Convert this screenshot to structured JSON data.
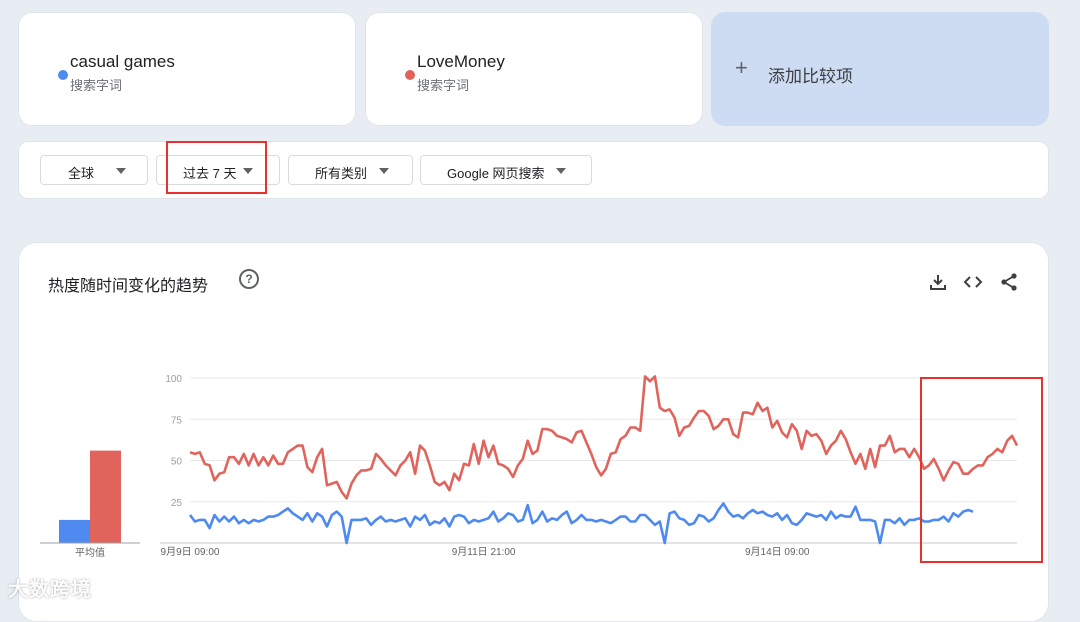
{
  "terms": [
    {
      "name": "casual games",
      "subtitle": "搜索字词",
      "color": "#4e8af0"
    },
    {
      "name": "LoveMoney",
      "subtitle": "搜索字词",
      "color": "#e0645c"
    }
  ],
  "add_compare": {
    "icon": "plus-icon",
    "label": "添加比较项"
  },
  "filters": [
    {
      "label": "全球",
      "icon": "caret-down-icon"
    },
    {
      "label": "过去 7 天",
      "icon": "caret-down-icon"
    },
    {
      "label": "所有类别",
      "icon": "caret-down-icon"
    },
    {
      "label": "Google 网页搜索",
      "icon": "caret-down-icon"
    }
  ],
  "chart_section": {
    "title": "热度随时间变化的趋势",
    "help_icon": "help-icon",
    "tools": [
      "download-icon",
      "embed-code-icon",
      "share-icon"
    ]
  },
  "watermark": "大数跨境",
  "chart_data": [
    {
      "type": "bar",
      "xlabel": "平均值",
      "categories": [
        "casual games",
        "LoveMoney"
      ],
      "values": [
        14,
        56
      ],
      "ylim": [
        0,
        100
      ],
      "colors": [
        "#4e8af0",
        "#e0645c"
      ]
    },
    {
      "type": "line",
      "ylim": [
        0,
        100
      ],
      "yticks": [
        100,
        75,
        50,
        25
      ],
      "grid": true,
      "x_tick_labels": [
        "9月9日 09:00",
        "9月11日 21:00",
        "9月14日 09:00"
      ],
      "x_tick_index": [
        0,
        60,
        120
      ],
      "series": [
        {
          "name": "LoveMoney",
          "color": "#e0645c",
          "values": [
            55,
            54,
            55,
            48,
            47,
            38,
            42,
            43,
            52,
            52,
            48,
            54,
            47,
            54,
            47,
            52,
            47,
            53,
            48,
            48,
            55,
            57,
            59,
            59,
            46,
            43,
            52,
            57,
            35,
            36,
            37,
            31,
            27,
            36,
            41,
            44,
            44,
            45,
            54,
            51,
            47,
            44,
            41,
            47,
            50,
            55,
            42,
            59,
            56,
            47,
            37,
            35,
            37,
            32,
            42,
            38,
            48,
            47,
            60,
            48,
            62,
            52,
            59,
            48,
            47,
            45,
            40,
            47,
            51,
            62,
            54,
            56,
            69,
            69,
            68,
            65,
            64,
            63,
            61,
            67,
            68,
            61,
            54,
            46,
            41,
            45,
            54,
            55,
            63,
            65,
            70,
            70,
            68,
            101,
            98,
            101,
            82,
            80,
            81,
            76,
            65,
            70,
            71,
            76,
            80,
            80,
            77,
            69,
            71,
            75,
            75,
            66,
            64,
            79,
            79,
            78,
            85,
            80,
            82,
            70,
            74,
            67,
            64,
            72,
            68,
            57,
            68,
            65,
            66,
            62,
            54,
            59,
            62,
            68,
            63,
            55,
            48,
            54,
            45,
            57,
            46,
            59,
            59,
            65,
            55,
            57,
            57,
            52,
            57,
            52,
            45,
            47,
            51,
            45,
            38,
            44,
            49,
            48,
            42,
            42,
            45,
            47,
            47,
            52,
            54,
            57,
            55,
            62,
            65,
            59
          ]
        },
        {
          "name": "casual games",
          "color": "#4e8af0",
          "values": [
            17,
            13,
            14,
            14,
            9,
            17,
            13,
            16,
            13,
            16,
            12,
            14,
            12,
            14,
            13,
            14,
            16,
            16,
            17,
            19,
            21,
            18,
            16,
            14,
            18,
            13,
            18,
            16,
            10,
            17,
            19,
            16,
            0,
            14,
            14,
            14,
            15,
            11,
            14,
            16,
            13,
            14,
            13,
            14,
            15,
            10,
            16,
            14,
            17,
            11,
            13,
            12,
            15,
            10,
            16,
            17,
            16,
            12,
            14,
            13,
            14,
            15,
            19,
            13,
            15,
            18,
            17,
            13,
            14,
            23,
            12,
            14,
            19,
            13,
            15,
            14,
            17,
            19,
            12,
            14,
            17,
            14,
            14,
            13,
            14,
            13,
            12,
            14,
            16,
            16,
            13,
            13,
            17,
            17,
            14,
            11,
            13,
            0,
            18,
            19,
            15,
            14,
            11,
            12,
            17,
            16,
            13,
            15,
            20,
            24,
            19,
            16,
            17,
            15,
            18,
            20,
            18,
            19,
            17,
            16,
            18,
            14,
            17,
            12,
            11,
            14,
            18,
            17,
            16,
            17,
            14,
            19,
            15,
            17,
            16,
            16,
            22,
            14,
            14,
            14,
            13,
            0,
            14,
            14,
            12,
            15,
            11,
            14,
            14,
            15,
            13,
            13,
            14,
            14,
            16,
            13,
            18,
            16,
            19,
            20,
            19
          ]
        }
      ]
    }
  ]
}
